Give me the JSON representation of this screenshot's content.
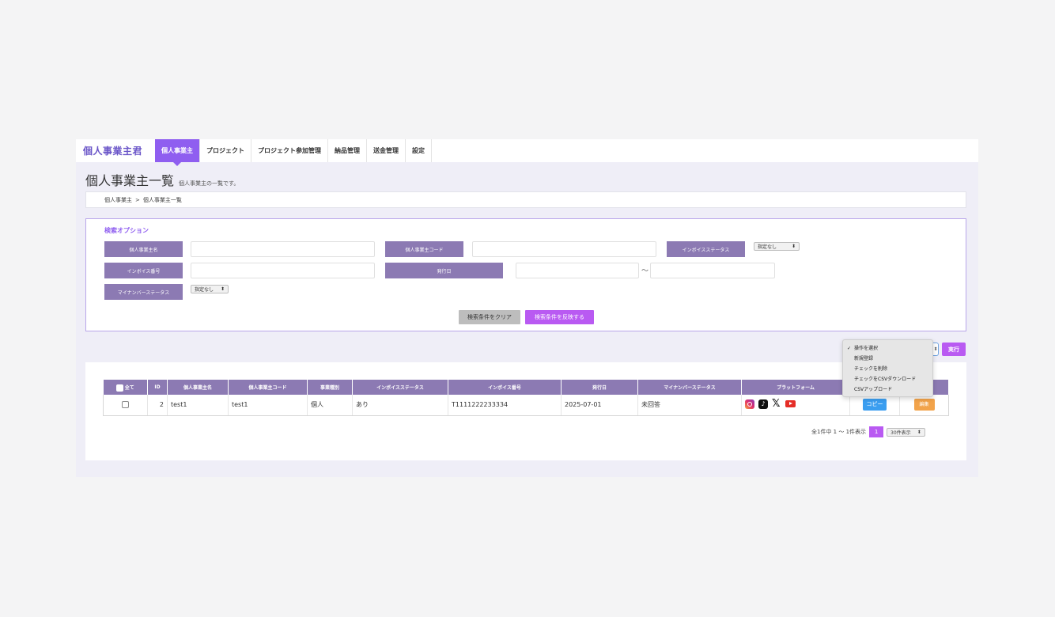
{
  "nav": {
    "brand": "個人事業主君",
    "items": [
      {
        "label": "個人事業主",
        "active": true
      },
      {
        "label": "プロジェクト",
        "active": false
      },
      {
        "label": "プロジェクト参加管理",
        "active": false
      },
      {
        "label": "納品管理",
        "active": false
      },
      {
        "label": "送金管理",
        "active": false
      },
      {
        "label": "設定",
        "active": false
      }
    ]
  },
  "page": {
    "title": "個人事業主一覧",
    "subtitle": "個人事業主の一覧です。"
  },
  "breadcrumb": {
    "root": "個人事業主",
    "separator": ">",
    "current": "個人事業主一覧"
  },
  "search": {
    "heading": "検索オプション",
    "labels": {
      "name": "個人事業主名",
      "code": "個人事業主コード",
      "invoice_status": "インボイスステータス",
      "invoice_number": "インボイス番号",
      "issue_date": "発行日",
      "mynumber_status": "マイナンバーステータス"
    },
    "invoice_status_value": "指定なし",
    "mynumber_status_value": "指定なし",
    "range_separator": "〜",
    "clear_label": "検索条件をクリア",
    "apply_label": "検索条件を反映する"
  },
  "actions": {
    "menu": [
      "操作を選択",
      "新規登録",
      "チェックを削除",
      "チェックをCSVダウンロード",
      "CSVアップロード"
    ],
    "selected": "操作を選択",
    "check_mark": "✓",
    "execute_label": "実行"
  },
  "table": {
    "columns": [
      "全て",
      "ID",
      "個人事業主名",
      "個人事業主コード",
      "事業種別",
      "インボイスステータス",
      "インボイス番号",
      "発行日",
      "マイナンバーステータス",
      "プラットフォーム",
      "",
      ""
    ],
    "rows": [
      {
        "id": "2",
        "name": "test1",
        "code": "test1",
        "type": "個人",
        "invoice_status": "あり",
        "invoice_number": "T1111222233334",
        "issue_date": "2025-07-01",
        "mynumber_status": "未回答",
        "platforms": [
          "instagram",
          "tiktok",
          "x",
          "youtube"
        ],
        "copy_label": "コピー",
        "edit_label": "編集"
      }
    ]
  },
  "pagination": {
    "summary": "全1件中 1 〜 1件表示",
    "current_page": "1",
    "per_page": "30件表示"
  },
  "icons": {
    "tiktok_glyph": "♪",
    "x_glyph": "𝕏",
    "select_arrow": "⬍"
  },
  "colors": {
    "brand": "#6a55c8",
    "accent": "#b95af2",
    "header_bg": "#8c7ab3",
    "copy": "#3b9ef0",
    "edit": "#f2a34a"
  }
}
